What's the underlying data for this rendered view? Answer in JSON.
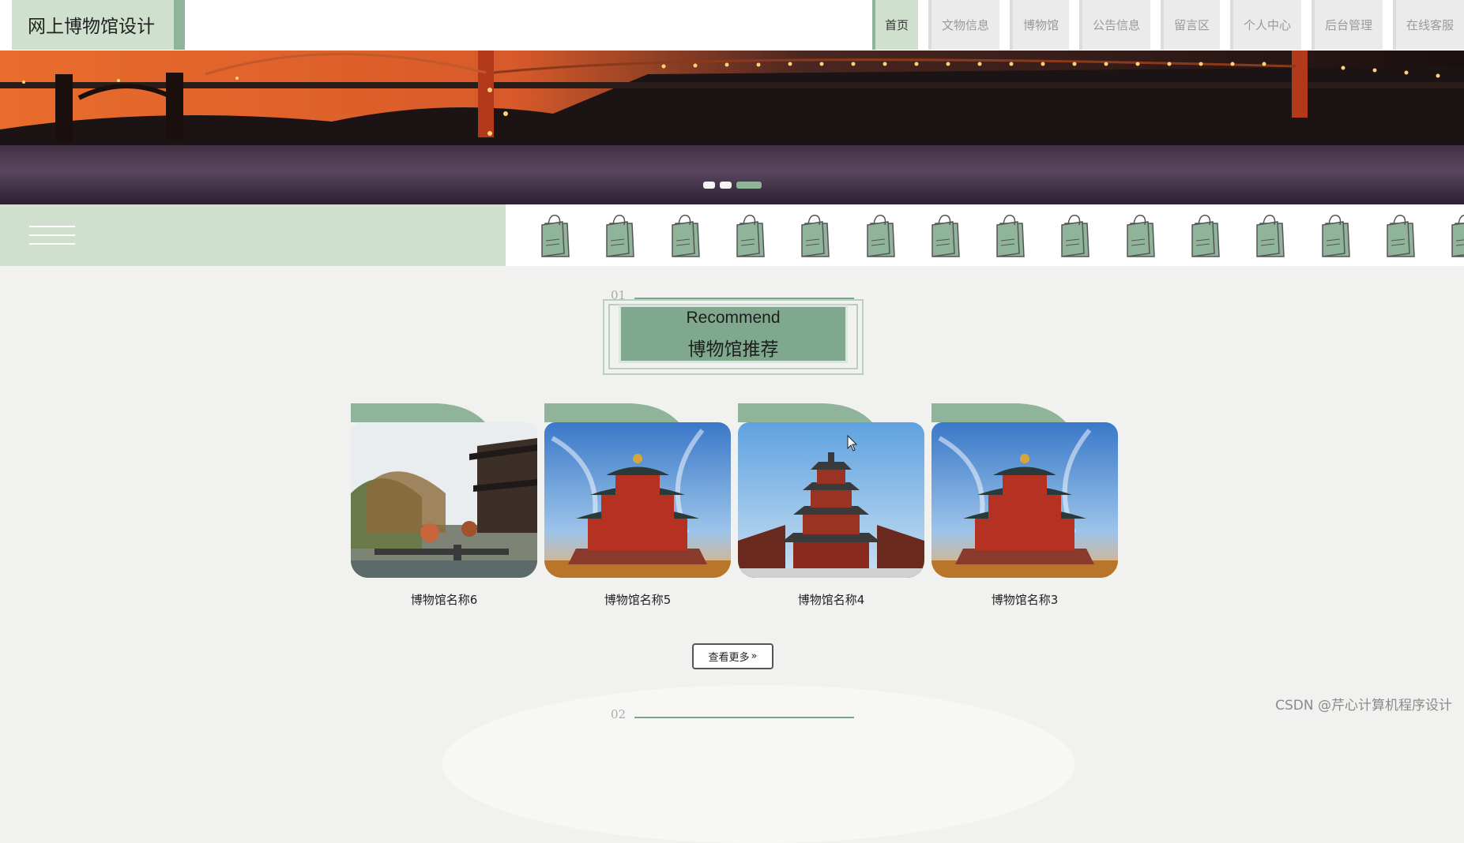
{
  "header": {
    "site_title": "网上博物馆设计",
    "nav": [
      {
        "label": "首页",
        "active": true
      },
      {
        "label": "文物信息",
        "active": false
      },
      {
        "label": "博物馆",
        "active": false
      },
      {
        "label": "公告信息",
        "active": false
      },
      {
        "label": "留言区",
        "active": false
      },
      {
        "label": "个人中心",
        "active": false
      },
      {
        "label": "后台管理",
        "active": false
      },
      {
        "label": "在线客服",
        "active": false
      }
    ]
  },
  "banner": {
    "slide_count": 3,
    "active_slide": 3
  },
  "strip": {
    "menu_icon": "hamburger-menu-icon",
    "tag_icon": "shopping-tag-icon"
  },
  "recommend": {
    "section_number": "01",
    "title_en": "Recommend",
    "title_cn": "博物馆推荐",
    "cards": [
      {
        "name": "博物馆名称6"
      },
      {
        "name": "博物馆名称5"
      },
      {
        "name": "博物馆名称4"
      },
      {
        "name": "博物馆名称3"
      }
    ],
    "more_label": "查看更多"
  },
  "next_section": {
    "section_number": "02"
  },
  "watermark": "CSDN @芹心计算机程序设计",
  "colors": {
    "accent": "#8fb49a",
    "accent_light": "#cfe0cf",
    "title_box": "#7fa88e",
    "page_bg": "#f1f1ef"
  }
}
